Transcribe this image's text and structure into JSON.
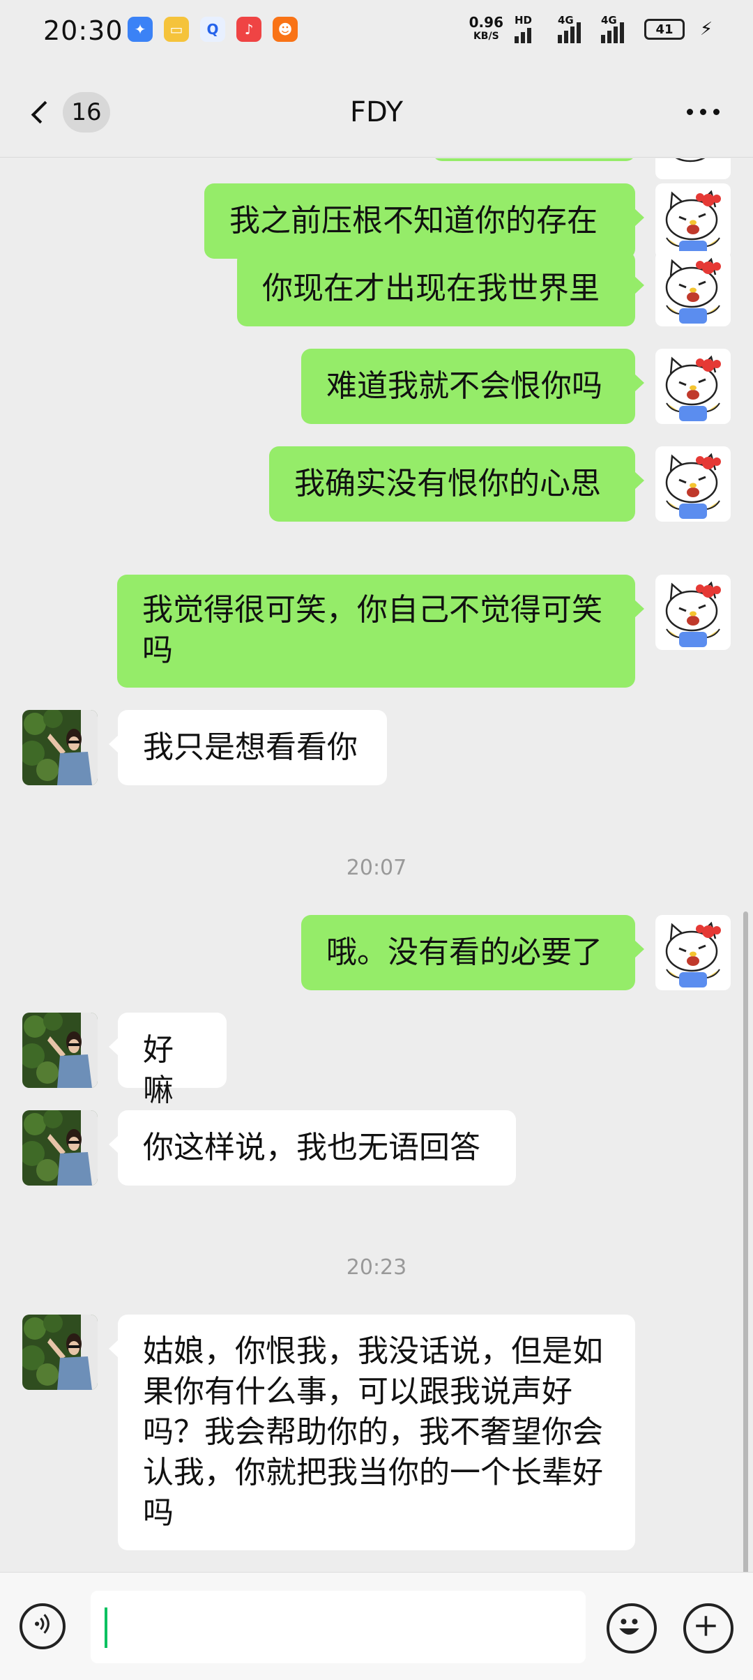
{
  "status_bar": {
    "time": "20:30",
    "net_speed": "0.96",
    "net_unit": "KB/S",
    "hd": "HD",
    "sig1": "4G",
    "sig2": "4G",
    "battery": "41"
  },
  "header": {
    "unread_count": "16",
    "title": "FDY"
  },
  "messages": [
    {
      "side": "me",
      "text": "我之前压根不知道你的存在"
    },
    {
      "side": "me",
      "text": "你现在才出现在我世界里"
    },
    {
      "side": "me",
      "text": "难道我就不会恨你吗"
    },
    {
      "side": "me",
      "text": "我确实没有恨你的心思"
    },
    {
      "side": "me",
      "line1": "我觉得很可笑，你自己不觉得可笑",
      "line2": "吗"
    },
    {
      "side": "them",
      "text": "我只是想看看你"
    },
    {
      "side": "me",
      "text": "哦。没有看的必要了"
    },
    {
      "side": "them",
      "text": "好嘛"
    },
    {
      "side": "them",
      "text": "你这样说，我也无语回答"
    },
    {
      "side": "them",
      "line1": "姑娘，你恨我，我没话说，但是如",
      "line2": "果你有什么事，可以跟我说声好",
      "line3": "吗？我会帮助你的，我不奢望你会",
      "line4": "认我，你就把我当你的一个长辈好",
      "line5": "吗"
    }
  ],
  "timestamps": [
    "20:07",
    "20:23"
  ],
  "colors": {
    "my_bubble": "#95ec69",
    "their_bubble": "#ffffff",
    "chat_background": "#ededed",
    "cursor": "#07c160"
  },
  "icons": {
    "back": "chevron-left-icon",
    "more": "more-dots-icon",
    "voice": "voice-icon",
    "emoji": "emoji-icon",
    "plus": "plus-icon"
  }
}
